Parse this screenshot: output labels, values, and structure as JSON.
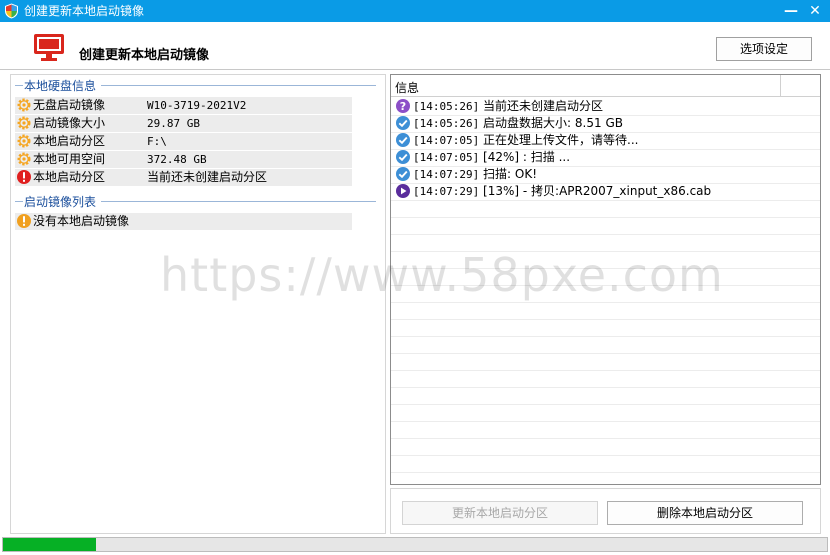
{
  "window": {
    "title": "创建更新本地启动镜像",
    "min_label": "—",
    "close_label": "✕"
  },
  "header": {
    "title": "创建更新本地启动镜像",
    "options_button": "选项设定"
  },
  "disk_info": {
    "group_title": "本地硬盘信息",
    "rows": [
      {
        "icon": "gear-icon",
        "label": "无盘启动镜像",
        "value": "W10-3719-2021V2"
      },
      {
        "icon": "gear-icon",
        "label": "启动镜像大小",
        "value": "29.87 GB"
      },
      {
        "icon": "gear-icon",
        "label": "本地启动分区",
        "value": "F:\\"
      },
      {
        "icon": "gear-icon",
        "label": "本地可用空间",
        "value": "372.48 GB"
      },
      {
        "icon": "error-icon",
        "label": "本地启动分区",
        "value": "当前还未创建启动分区"
      }
    ]
  },
  "image_list": {
    "group_title": "启动镜像列表",
    "rows": [
      {
        "icon": "warning-icon",
        "label": "没有本地启动镜像"
      }
    ]
  },
  "log": {
    "column_header": "信息",
    "rows": [
      {
        "icon": "question-icon",
        "time": "[14:05:26]",
        "text": " 当前还未创建启动分区"
      },
      {
        "icon": "check-icon",
        "time": "[14:05:26]",
        "text": " 启动盘数据大小: 8.51 GB"
      },
      {
        "icon": "check-icon",
        "time": "[14:07:05]",
        "text": " 正在处理上传文件，请等待..."
      },
      {
        "icon": "check-icon",
        "time": "[14:07:05]",
        "text": " [42%] : 扫描 ..."
      },
      {
        "icon": "check-icon",
        "time": "[14:07:29]",
        "text": " 扫描: OK!"
      },
      {
        "icon": "play-icon",
        "time": "[14:07:29]",
        "text": " [13%] - 拷贝:APR2007_xinput_x86.cab"
      }
    ]
  },
  "watermark": "https://www.58pxe.com",
  "buttons": {
    "update": "更新本地启动分区",
    "delete": "删除本地启动分区"
  },
  "progress": {
    "percent": 11.3
  },
  "colors": {
    "titlebar": "#0a9be6",
    "group_title": "#1b4f9c",
    "progress_fill": "#06b025",
    "gear": "#f5a623",
    "error": "#e02020",
    "warning": "#f0a020",
    "check": "#3d8fd6",
    "question": "#8c4fc8",
    "play": "#5a2d9c"
  }
}
